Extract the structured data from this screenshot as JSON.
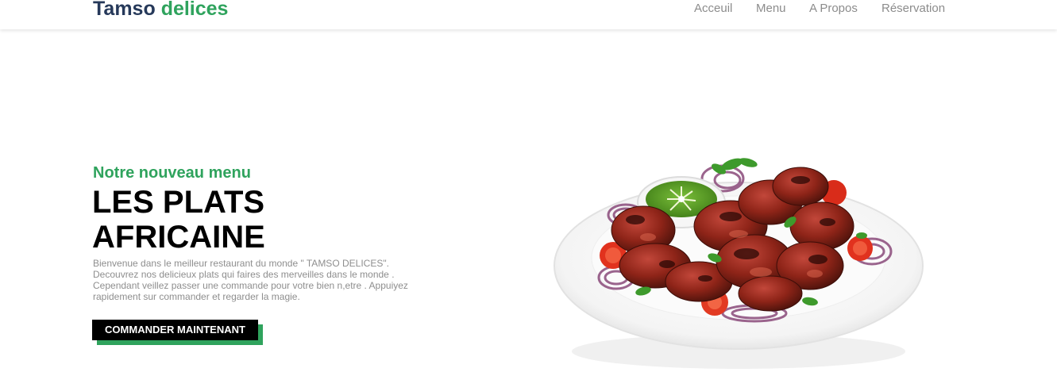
{
  "header": {
    "logo_part1": "Tamso",
    "logo_part2": "delices",
    "nav": [
      {
        "label": "Acceuil"
      },
      {
        "label": "Menu"
      },
      {
        "label": "A Propos"
      },
      {
        "label": "Réservation"
      }
    ]
  },
  "hero": {
    "kicker": "Notre nouveau menu",
    "title_line1": "LES PLATS",
    "title_line2": "AFRICAINE",
    "description": "Bienvenue dans le meilleur restaurant du monde \" TAMSO DELICES\". Decouvrez nos delicieux plats qui faires des merveilles dans le monde . Cependant veillez passer une commande pour votre bien n,etre . Appuiyez rapidement sur commander et regarder la magie.",
    "cta_label": "COMMANDER MAINTENANT"
  },
  "colors": {
    "brand_dark": "#26395a",
    "brand_green": "#2fa35d",
    "nav_text": "#8c8c8c",
    "cta_bg": "#000000"
  }
}
